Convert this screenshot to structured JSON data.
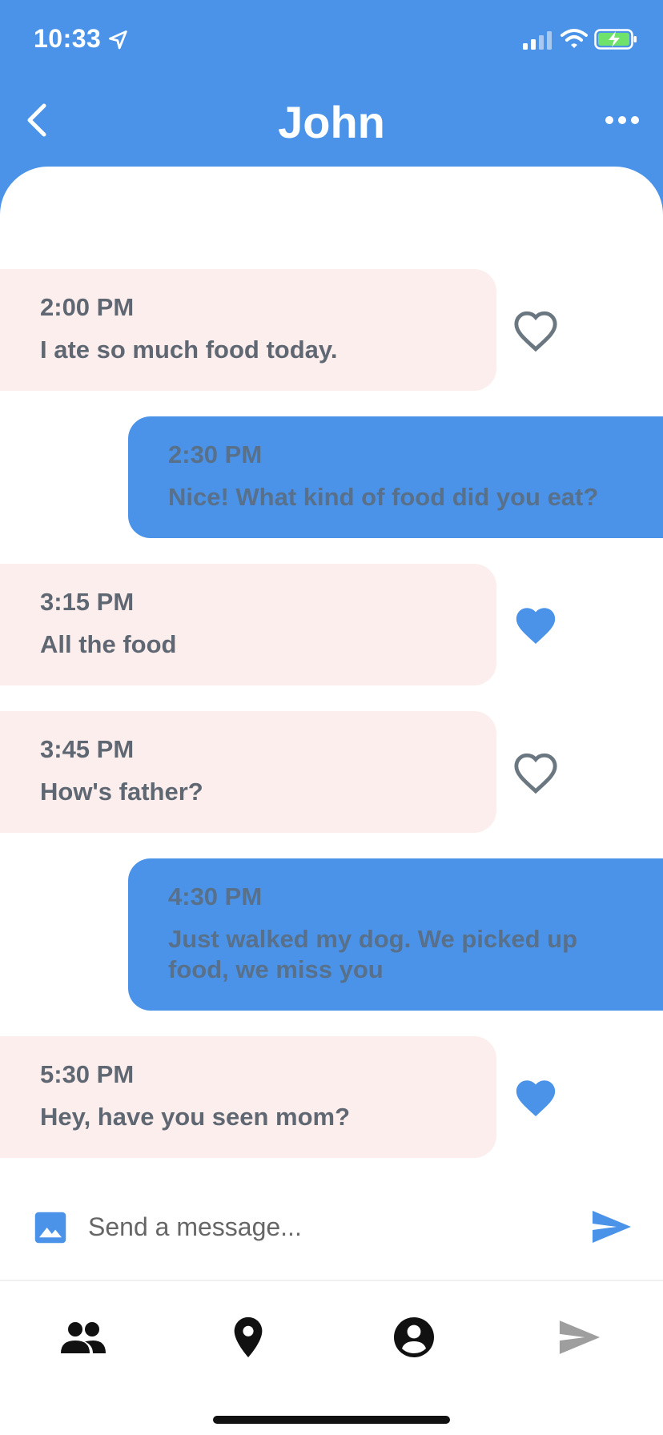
{
  "status_bar": {
    "time": "10:33"
  },
  "header": {
    "title": "John",
    "back_icon": "chevron-left-icon",
    "more_icon": "more-horizontal-icon"
  },
  "messages": [
    {
      "direction": "received",
      "time": "2:00 PM",
      "text": "I ate so much food today.",
      "liked": false
    },
    {
      "direction": "sent",
      "time": "2:30 PM",
      "text": "Nice! What kind of food did you eat?"
    },
    {
      "direction": "received",
      "time": "3:15 PM",
      "text": "All the food",
      "liked": true
    },
    {
      "direction": "received",
      "time": "3:45 PM",
      "text": "How's father?",
      "liked": false
    },
    {
      "direction": "sent",
      "time": "4:30 PM",
      "text": "Just walked my dog. We picked up food, we miss you"
    },
    {
      "direction": "received",
      "time": "5:30 PM",
      "text": "Hey, have you seen mom?",
      "liked": true
    }
  ],
  "composer": {
    "placeholder": "Send a message...",
    "value": "",
    "image_icon": "image-icon",
    "send_icon": "send-icon"
  },
  "bottom_nav": [
    {
      "icon": "people-icon"
    },
    {
      "icon": "location-pin-icon"
    },
    {
      "icon": "account-circle-icon"
    },
    {
      "icon": "send-icon"
    }
  ],
  "colors": {
    "primary": "#4a93e8",
    "received_bubble": "#fdeeee",
    "text_gray": "#5f6872",
    "heart_outline": "#6b7780",
    "heart_filled": "#4a93e8"
  }
}
